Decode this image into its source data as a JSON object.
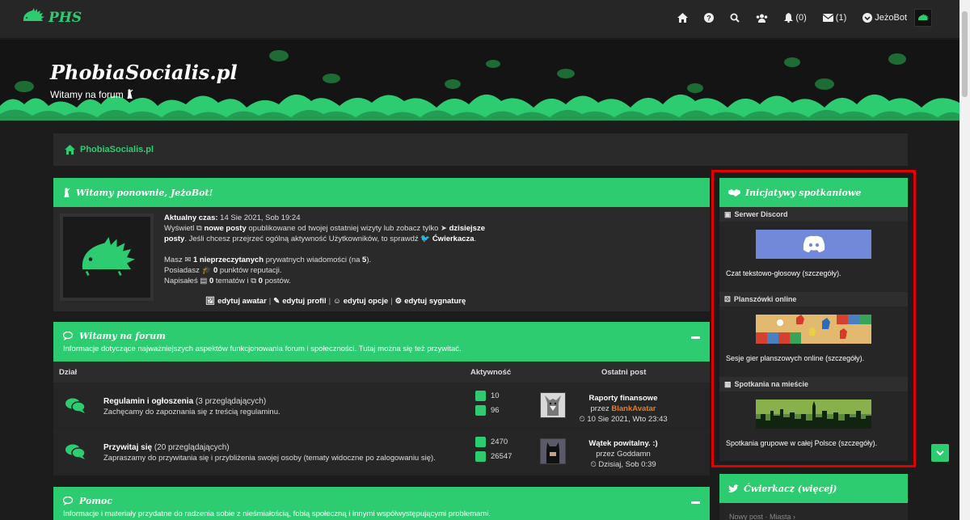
{
  "nav": {
    "logo_text": "PHS",
    "notifications_count": "(0)",
    "messages_count": "(1)",
    "username": "JeżoBot"
  },
  "banner": {
    "title": "PhobiaSocialis.pl",
    "subtitle": "Witamy na forum"
  },
  "breadcrumb": {
    "home": "PhobiaSocialis.pl"
  },
  "welcome": {
    "title": "Witamy ponownie, JeżoBot!",
    "current_time_label": "Aktualny czas:",
    "current_time": "14 Sie 2021, Sob 19:24",
    "line1_pre": "Wyświetl",
    "new_posts": "nowe posty",
    "line1_mid": "opublikowane od twojej ostatniej wizyty lub zobacz tylko",
    "today_posts": "dzisiejsze posty",
    "line2_mid": ". Jeśli chcesz przejrzeć ogólną aktywność Użytkowników, to sprawdź",
    "cwierkacz": "Ćwierkacza",
    "line2_end": ".",
    "msg_pre": "Masz",
    "msg_count": "1 nieprzeczytanych",
    "msg_post": "prywatnych wiadomości (na",
    "msg_total": "5",
    "msg_end": ").",
    "rep_pre": "Posiadasz",
    "rep_count": "0",
    "rep_post": "punktów reputacji.",
    "wrote_pre": "Napisałeś",
    "topics_count": "0",
    "wrote_mid": "tematów i",
    "posts_count": "0",
    "wrote_end": "postów.",
    "links": [
      "edytuj awatar",
      "edytuj profil",
      "edytuj opcje",
      "edytuj sygnaturę"
    ]
  },
  "forum_section": {
    "title": "Witamy na forum",
    "description": "Informacje dotyczące najważniejszych aspektów funkcjonowania forum i społeczności. Tutaj można się też przywitać.",
    "columns": {
      "forum": "Dział",
      "activity": "Aktywność",
      "last_post": "Ostatni post"
    },
    "rows": [
      {
        "name": "Regulamin i ogłoszenia",
        "viewers": "(3 przeglądających)",
        "description": "Zachęcamy do zapoznania się z treścią regulaminu.",
        "topics": "10",
        "posts": "96",
        "last_title": "Raporty finansowe",
        "by_label": "przez",
        "last_author": "BlankAvatar",
        "last_date": "10 Sie 2021, Wto 23:43"
      },
      {
        "name": "Przywitaj się",
        "viewers": "(20 przeglądających)",
        "description": "Zapraszamy do przywitania się i przybliżenia swojej osoby (tematy widoczne po zalogowaniu się).",
        "topics": "2470",
        "posts": "26547",
        "last_title": "Wątek powitalny. :)",
        "by_label": "przez",
        "last_author": "Goddamn",
        "last_date": "Dzisiaj, Sob 0:39"
      }
    ]
  },
  "help_section": {
    "title": "Pomoc",
    "description": "Informacje i materiały przydatne do radzenia sobie z nieśmiałością, fobią społeczną i innymi współwystępującymi problemami."
  },
  "sidebar": {
    "title": "Inicjatywy spotkaniowe",
    "sections": [
      {
        "label": "Serwer Discord",
        "text_pre": "Czat tekstowo-głosowy (",
        "link": "szczegóły",
        "text_post": ")."
      },
      {
        "label": "Planszówki online",
        "text_pre": "Sesje gier planszowych online (",
        "link": "szczegóły",
        "text_post": ")."
      },
      {
        "label": "Spotkania na mieście",
        "text_pre": "Spotkania grupowe w całej Polsce (",
        "link": "szczegóły",
        "text_post": ")."
      }
    ]
  },
  "tweet_panel": {
    "title": "Ćwierkacz (więcej)",
    "sub": "Nowy post · Miasta ›"
  },
  "colors": {
    "accent": "#2ecc71",
    "highlight": "#e00000",
    "orange": "#e67e22"
  }
}
